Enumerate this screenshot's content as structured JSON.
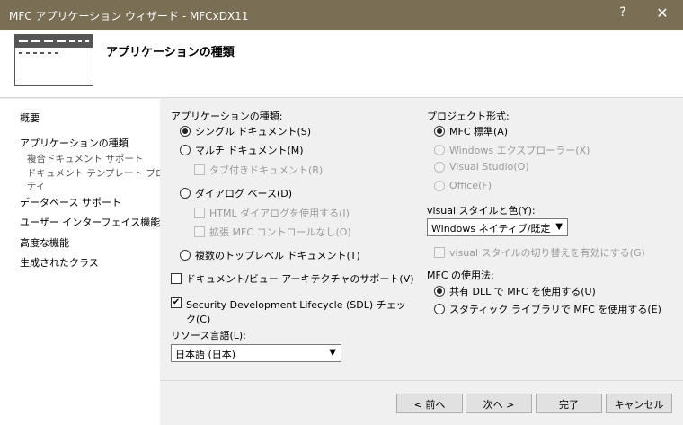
{
  "window": {
    "title": "MFC アプリケーション ウィザード - MFCxDX11",
    "help_label": "?",
    "close_label": "✕"
  },
  "header": {
    "title": "アプリケーションの種類"
  },
  "sidebar": {
    "items": [
      {
        "label": "概要"
      },
      {
        "label": "アプリケーションの種類"
      },
      {
        "label": "複合ドキュメント サポート"
      },
      {
        "label": "ドキュメント テンプレート プロパ"
      },
      {
        "label": "ティ"
      },
      {
        "label": "データベース サポート"
      },
      {
        "label": "ユーザー インターフェイス機能"
      },
      {
        "label": "高度な機能"
      },
      {
        "label": "生成されたクラス"
      }
    ]
  },
  "app_type": {
    "label": "アプリケーションの種類:",
    "options": [
      {
        "label": "シングル ドキュメント(S)",
        "selected": true
      },
      {
        "label": "マルチ ドキュメント(M)",
        "selected": false
      },
      {
        "label": "タブ付きドキュメント(B)",
        "checked": false
      },
      {
        "label": "ダイアログ ベース(D)",
        "selected": false
      },
      {
        "label": "HTML ダイアログを使用する(I)",
        "checked": false
      },
      {
        "label": "拡張 MFC コントロールなし(O)",
        "checked": false
      },
      {
        "label": "複数のトップレベル ドキュメント(T)",
        "selected": false
      }
    ]
  },
  "doc_view": {
    "label": "ドキュメント/ビュー アーキテクチャのサポート(V)",
    "checked": false
  },
  "sdl": {
    "label_line1": "Security Development Lifecycle (SDL) チェッ",
    "label_line2": "ク(C)",
    "checked": true,
    "check_mark": "✔"
  },
  "resource_lang": {
    "label": "リソース言語(L):",
    "value": "日本語 (日本)"
  },
  "project_style": {
    "label": "プロジェクト形式:",
    "options": [
      {
        "label": "MFC 標準(A)",
        "selected": true
      },
      {
        "label": "Windows エクスプローラー(X)",
        "selected": false
      },
      {
        "label": "Visual Studio(O)",
        "selected": false
      },
      {
        "label": "Office(F)",
        "selected": false
      }
    ]
  },
  "visual_style": {
    "label": "visual スタイルと色(Y):",
    "value": "Windows ネイティブ/既定",
    "toggle_label": "visual スタイルの切り替えを有効にする(G)",
    "toggle_checked": false
  },
  "mfc_use": {
    "label": "MFC の使用法:",
    "options": [
      {
        "label": "共有 DLL で MFC を使用する(U)",
        "selected": true
      },
      {
        "label": "スタティック ライブラリで MFC を使用する(E)",
        "selected": false
      }
    ]
  },
  "buttons": {
    "back": "< 前へ",
    "next": "次へ >",
    "finish": "完了",
    "cancel": "キャンセル"
  },
  "icons": {
    "dropdown_arrow": "▼"
  },
  "colors": {
    "titlebar": "#7a6f55",
    "content_bg": "#f0f0f0",
    "sidebar_bg": "#ffffff"
  }
}
